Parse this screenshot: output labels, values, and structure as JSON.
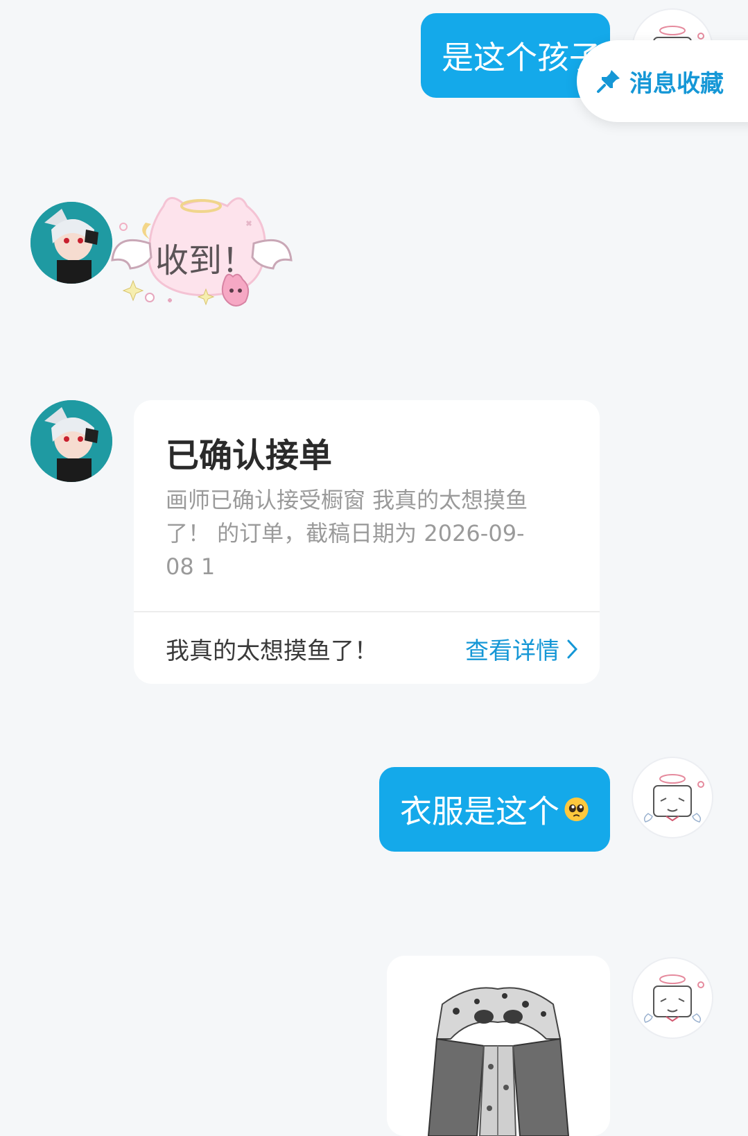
{
  "messages": {
    "m1_text": "是这个孩子",
    "sticker_text": "收到！",
    "m3_text": "衣服是这个"
  },
  "popup": {
    "label": "消息收藏",
    "icon": "pin-icon"
  },
  "order_card": {
    "title": "已确认接单",
    "description": "画师已确认接受橱窗 我真的太想摸鱼了！ 的订单，截稿日期为 2026-09-08 1",
    "footer_left": "我真的太想摸鱼了！",
    "footer_right": "查看详情"
  },
  "colors": {
    "bubble_out": "#14a9ea",
    "link": "#1597d6",
    "background": "#f5f7f9"
  }
}
